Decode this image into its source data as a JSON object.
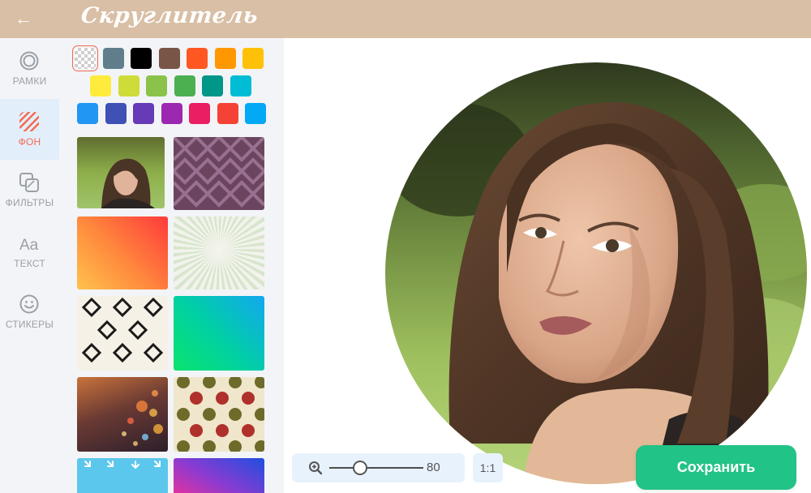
{
  "header": {
    "back_icon": "arrow-left-icon",
    "logo": "Скруглитель",
    "background": "#d8bfa5"
  },
  "nav": {
    "items": [
      {
        "id": "frames",
        "icon": "ring-icon",
        "label": "РАМКИ",
        "active": false
      },
      {
        "id": "background",
        "icon": "hatched-square-icon",
        "label": "ФОН",
        "active": true
      },
      {
        "id": "filters",
        "icon": "layers-icon",
        "label": "ФИЛЬТРЫ",
        "active": false
      },
      {
        "id": "text",
        "icon": "text-aa-icon",
        "label": "ТЕКСТ",
        "active": false
      },
      {
        "id": "stickers",
        "icon": "smiley-icon",
        "label": "СТИКЕРЫ",
        "active": false
      }
    ],
    "active_color": "#f26a4f"
  },
  "colors": {
    "selected": "transparent",
    "rows": [
      [
        "transparent",
        "#607d8b",
        "#000000",
        "#795548",
        "#ff5722",
        "#ff9800",
        "#ffc107"
      ],
      [
        "#ffeb3b",
        "#cddc39",
        "#8bc34a",
        "#4caf50",
        "#009688",
        "#00bcd4"
      ],
      [
        "#2196f3",
        "#3f51b5",
        "#673ab7",
        "#9c27b0",
        "#e91e63",
        "#f44336",
        "#03a9f4"
      ]
    ]
  },
  "backgrounds": [
    {
      "name": "bg-photo-portrait",
      "kind": "photo"
    },
    {
      "name": "bg-purple-diamonds",
      "kind": "pattern"
    },
    {
      "name": "bg-orange-gradient",
      "kind": "gradient"
    },
    {
      "name": "bg-sunburst",
      "kind": "pattern"
    },
    {
      "name": "bg-black-diamonds",
      "kind": "pattern"
    },
    {
      "name": "bg-green-blue-gradient",
      "kind": "gradient"
    },
    {
      "name": "bg-bokeh",
      "kind": "photo"
    },
    {
      "name": "bg-polka-dots",
      "kind": "pattern"
    },
    {
      "name": "bg-blue-arrows",
      "kind": "pattern"
    },
    {
      "name": "bg-pink-blue-gradient",
      "kind": "gradient"
    }
  ],
  "controls": {
    "zoom_icon": "zoom-in-icon",
    "zoom_level": 80,
    "zoom_display": "80",
    "zoom_fraction": 0.33,
    "ratio_label": "1:1",
    "save_label": "Сохранить",
    "save_color": "#22c386"
  }
}
